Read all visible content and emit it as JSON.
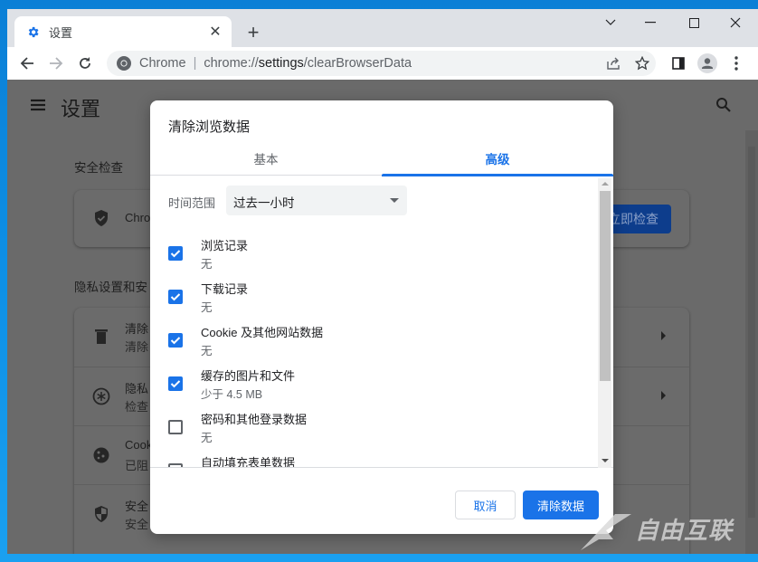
{
  "browser": {
    "tab": {
      "title": "设置",
      "icon": "gear-icon"
    },
    "window_controls": [
      "tab-search",
      "minimize",
      "maximize",
      "close"
    ],
    "omnibox": {
      "site_name": "Chrome",
      "url_prefix": "chrome://",
      "url_host": "settings",
      "url_path": "/clearBrowserData"
    }
  },
  "settings_page": {
    "title": "设置",
    "safety_check": {
      "section_title": "安全检查",
      "row_text": "Chro",
      "button_label": "立即检查"
    },
    "privacy": {
      "section_title": "隐私设置和安",
      "rows": [
        {
          "title": "清除",
          "subtitle": "清除",
          "icon": "trash-icon"
        },
        {
          "title": "隐私",
          "subtitle": "检查",
          "icon": "privacy-guide-icon"
        },
        {
          "title": "Cook",
          "subtitle": "已阻",
          "icon": "cookie-icon"
        },
        {
          "title": "安全",
          "subtitle": "安全",
          "icon": "security-shield-icon"
        }
      ]
    }
  },
  "dialog": {
    "title": "清除浏览数据",
    "tabs": [
      {
        "label": "基本",
        "active": false
      },
      {
        "label": "高级",
        "active": true
      }
    ],
    "time_range": {
      "label": "时间范围",
      "value": "过去一小时"
    },
    "options": [
      {
        "title": "浏览记录",
        "subtitle": "无",
        "checked": true
      },
      {
        "title": "下载记录",
        "subtitle": "无",
        "checked": true
      },
      {
        "title": "Cookie 及其他网站数据",
        "subtitle": "无",
        "checked": true
      },
      {
        "title": "缓存的图片和文件",
        "subtitle": "少于 4.5 MB",
        "checked": true
      },
      {
        "title": "密码和其他登录数据",
        "subtitle": "无",
        "checked": false
      },
      {
        "title": "自动填充表单数据",
        "subtitle": "",
        "checked": false
      }
    ],
    "cancel_label": "取消",
    "confirm_label": "清除数据"
  },
  "watermark": {
    "text": "自由互联"
  },
  "colors": {
    "accent": "#1a73e8",
    "overlay": "#6a6a6a"
  }
}
